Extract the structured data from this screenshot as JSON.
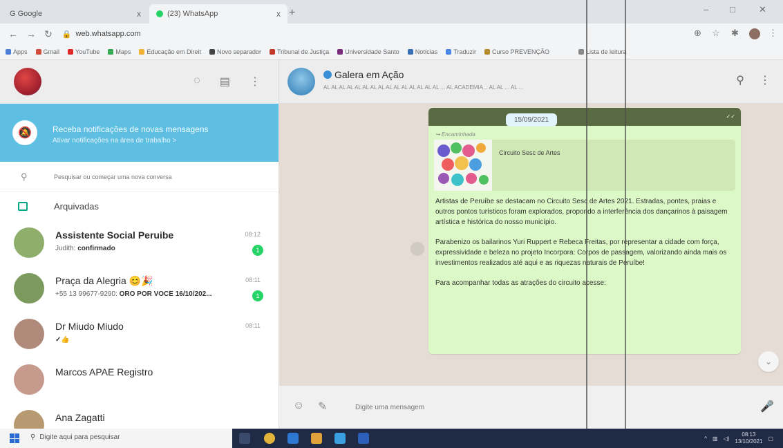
{
  "browser": {
    "tabs": [
      {
        "label": "G Google",
        "close": "x"
      },
      {
        "label": "(23) WhatsApp",
        "close": "x"
      }
    ],
    "new_tab": "+",
    "url": "web.whatsapp.com",
    "bookmarks": [
      "Apps",
      "Gmail",
      "YouTube",
      "Maps",
      "Educação em Direit",
      "Novo separador",
      "Tribunal de Justiça",
      "Universidade Santo",
      "Notícias",
      "Traduzir",
      "Curso PREVENÇÃO",
      "Lista de leitura"
    ]
  },
  "sidebar": {
    "notification": {
      "title": "Receba notificações de novas mensagens",
      "subtitle": "Ativar notificações na área de trabalho >"
    },
    "search_placeholder": "Pesquisar ou começar uma nova conversa",
    "archived_label": "Arquivadas",
    "chats": [
      {
        "name": "Assistente Social Peruibe",
        "bold": true,
        "preview_prefix": "Judith:",
        "preview": "confirmado",
        "time": "08:12",
        "unread": "1",
        "avatar_color": "#8fae6c"
      },
      {
        "name": "Praça da Alegria 😊🎉",
        "bold": false,
        "preview_prefix": "+55 13 99677-9290:",
        "preview": "ORO POR VOCÊ 16/10/202...",
        "time": "08:11",
        "unread": "1",
        "avatar_color": "#7d9a5e"
      },
      {
        "name": "Dr Miudo Miudo",
        "bold": false,
        "preview_prefix": "",
        "preview": "✓👍",
        "time": "08:11",
        "unread": "",
        "avatar_color": "#b08a7a"
      },
      {
        "name": "Marcos APAE Registro",
        "bold": false,
        "preview_prefix": "",
        "preview": "",
        "time": "",
        "unread": "",
        "avatar_color": "#c79a8e"
      },
      {
        "name": "Ana Zagatti",
        "bold": false,
        "preview_prefix": "",
        "preview": "",
        "time": "",
        "unread": "",
        "avatar_color": "#b79a72"
      }
    ]
  },
  "conversation": {
    "group_name": "Galera em Ação",
    "members": "AL AL AL AL AL AL AL AL AL AL AL AL AL AL AL ... AL ACADEMIA... AL AL ... AL ...",
    "date_pill": "15/09/2021",
    "link_title": "Circuito Sesc de Artes",
    "message_paragraphs": [
      "Artistas de Peruíbe se destacam no Circuito Sesc de Artes 2021. Estradas, pontes, praias e outros pontos turísticos foram explorados, propondo a interferência dos dançarinos à paisagem artística e histórica do nosso município.",
      "Parabenizo os bailarinos Yuri Ruppert e Rebeca Freitas, por representar a cidade com força, expressividade e beleza no projeto Incorpora: Corpos de passagem, valorizando ainda mais os investimentos realizados até aqui e as riquezas naturais de Peruíbe!",
      "Para acompanhar todas as atrações do circuito acesse:"
    ],
    "composer_placeholder": "Digite uma mensagem"
  },
  "taskbar": {
    "search_placeholder": "Digite aqui para pesquisar",
    "time": "08:13",
    "date": "13/10/2021"
  }
}
